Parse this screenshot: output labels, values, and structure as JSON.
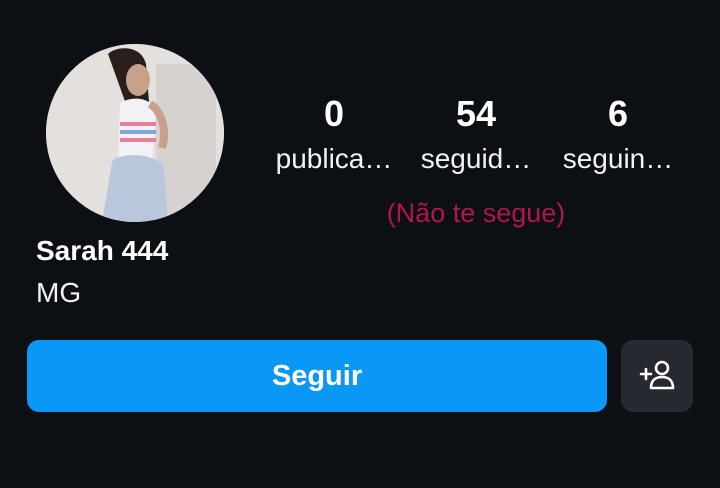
{
  "profile": {
    "name": "Sarah 444",
    "bio": "MG",
    "avatar_icon": "profile-photo"
  },
  "stats": [
    {
      "value": "0",
      "label": "publica…"
    },
    {
      "value": "54",
      "label": "seguid…"
    },
    {
      "value": "6",
      "label": "seguin…"
    }
  ],
  "follow_status": "(Não te segue)",
  "actions": {
    "follow_label": "Seguir",
    "suggest_icon": "add-person-icon"
  },
  "colors": {
    "background": "#0c0f14",
    "follow_button": "#0a98f7",
    "secondary_button": "#262a30",
    "status_text": "#b0164a"
  }
}
